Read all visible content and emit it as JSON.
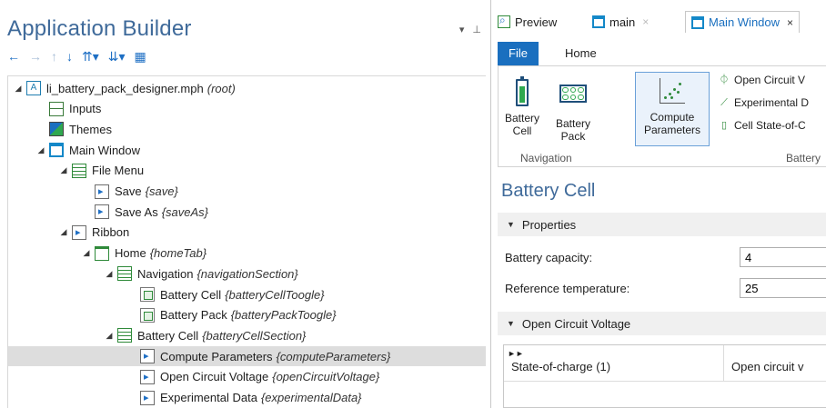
{
  "left_pane": {
    "title": "Application Builder",
    "pane_controls": [
      "▾",
      "⊥"
    ],
    "toolbar": [
      {
        "icon": "arrow-left-icon",
        "glyph": "←"
      },
      {
        "icon": "arrow-right-icon",
        "glyph": "→"
      },
      {
        "icon": "arrow-up-icon",
        "glyph": "↑"
      },
      {
        "icon": "arrow-down-icon",
        "glyph": "↓"
      },
      {
        "icon": "sort-ascending-icon",
        "glyph": "⇈▾"
      },
      {
        "icon": "sort-descending-icon",
        "glyph": "⇊▾"
      },
      {
        "icon": "form-editor-icon",
        "glyph": "▦"
      }
    ],
    "tree": [
      {
        "label": "li_battery_pack_designer.mph",
        "tag": "(root)",
        "level": 0,
        "caret": "◢",
        "icon": "file"
      },
      {
        "label": "Inputs",
        "tag": "",
        "level": 1,
        "caret": "",
        "icon": "inputs"
      },
      {
        "label": "Themes",
        "tag": "",
        "level": 1,
        "caret": "",
        "icon": "themes"
      },
      {
        "label": "Main Window",
        "tag": "",
        "level": 1,
        "caret": "◢",
        "icon": "win"
      },
      {
        "label": "File Menu",
        "tag": "",
        "level": 2,
        "caret": "◢",
        "icon": "menu"
      },
      {
        "label": "Save",
        "tag": "{save}",
        "level": 3,
        "caret": "",
        "icon": "button"
      },
      {
        "label": "Save As",
        "tag": "{saveAs}",
        "level": 3,
        "caret": "",
        "icon": "button"
      },
      {
        "label": "Ribbon",
        "tag": "",
        "level": 2,
        "caret": "◢",
        "icon": "ribbon"
      },
      {
        "label": "Home",
        "tag": "{homeTab}",
        "level": 3,
        "caret": "◢",
        "icon": "tab"
      },
      {
        "label": "Navigation",
        "tag": "{navigationSection}",
        "level": 4,
        "caret": "◢",
        "icon": "sect"
      },
      {
        "label": "Battery Cell",
        "tag": "{batteryCellToogle}",
        "level": 5,
        "caret": "",
        "icon": "toggle"
      },
      {
        "label": "Battery Pack",
        "tag": "{batteryPackToogle}",
        "level": 5,
        "caret": "",
        "icon": "toggle"
      },
      {
        "label": "Battery Cell",
        "tag": "{batteryCellSection}",
        "level": 4,
        "caret": "◢",
        "icon": "sect"
      },
      {
        "label": "Compute Parameters",
        "tag": "{computeParameters}",
        "level": 5,
        "caret": "",
        "icon": "button",
        "selected": true
      },
      {
        "label": "Open Circuit Voltage",
        "tag": "{openCircuitVoltage}",
        "level": 5,
        "caret": "",
        "icon": "button"
      },
      {
        "label": "Experimental Data",
        "tag": "{experimentalData}",
        "level": 5,
        "caret": "",
        "icon": "button"
      }
    ]
  },
  "right_pane": {
    "doc_tabs": [
      {
        "label": "Preview",
        "icon": "preview-icon",
        "close": "",
        "active": false
      },
      {
        "label": "main",
        "icon": "window-icon",
        "close": "×",
        "active": false
      },
      {
        "label": "Main Window",
        "icon": "window-icon",
        "close": "×",
        "active": true
      }
    ],
    "ribbon_tabs": {
      "file": "File",
      "home": "Home"
    },
    "ribbon": {
      "battery_cell": {
        "line1": "Battery",
        "line2": "Cell"
      },
      "battery_pack": {
        "line1": "Battery",
        "line2": "Pack"
      },
      "compute": {
        "line1": "Compute",
        "line2": "Parameters"
      },
      "small_buttons": [
        {
          "label": "Open Circuit V",
          "glyph": "⏀"
        },
        {
          "label": "Experimental D",
          "glyph": "⟋"
        },
        {
          "label": "Cell State-of-C",
          "glyph": "▯"
        }
      ],
      "group_navigation": "Navigation",
      "group_battery": "Battery"
    },
    "form": {
      "title": "Battery Cell",
      "properties_section": "Properties",
      "battery_capacity_label": "Battery capacity:",
      "battery_capacity_value": "4",
      "reference_temperature_label": "Reference temperature:",
      "reference_temperature_value": "25",
      "ocv_section": "Open Circuit Voltage",
      "table_col1": "State-of-charge (1)",
      "table_col2": "Open circuit v"
    }
  },
  "colors": {
    "accent_blue": "#1a6fbf",
    "title_blue": "#3f6a9a",
    "selected_row": "#dddddd",
    "section_header": "#f0f0f0"
  }
}
